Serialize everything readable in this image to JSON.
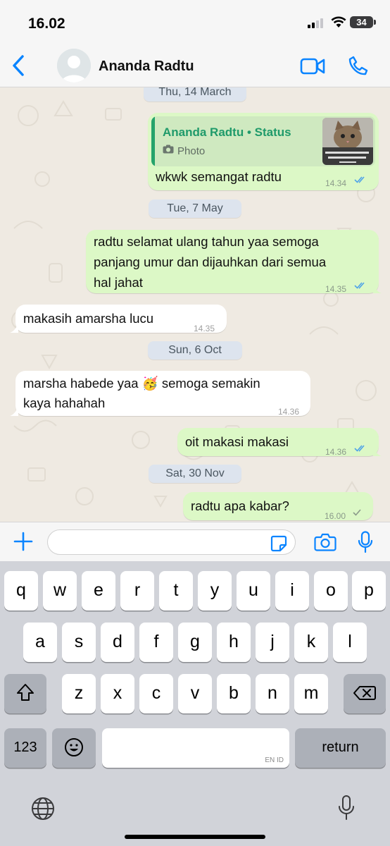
{
  "status_bar": {
    "time": "16.02",
    "battery": "34"
  },
  "header": {
    "contact_name": "Ananda Radtu"
  },
  "messages": [
    {
      "type": "date",
      "label": "Thu, 14 March"
    },
    {
      "type": "outgoing_reply",
      "quote_author": "Ananda Radtu • Status",
      "quote_type": "Photo",
      "text": "wkwk semangat radtu",
      "time": "14.34",
      "status": "read"
    },
    {
      "type": "date",
      "label": "Tue, 7 May"
    },
    {
      "type": "outgoing",
      "lines": [
        "radtu selamat ulang tahun yaa semoga",
        "panjang umur dan dijauhkan dari semua",
        "hal jahat"
      ],
      "time": "14.35",
      "status": "read"
    },
    {
      "type": "incoming",
      "lines": [
        "makasih amarsha lucu"
      ],
      "time": "14.35"
    },
    {
      "type": "date",
      "label": "Sun, 6 Oct"
    },
    {
      "type": "incoming",
      "lines": [
        "marsha habede yaa 🥳 semoga semakin",
        "kaya hahahah"
      ],
      "time": "14.36"
    },
    {
      "type": "outgoing",
      "lines": [
        "oit makasi makasi"
      ],
      "time": "14.36",
      "status": "read"
    },
    {
      "type": "date",
      "label": "Sat, 30 Nov"
    },
    {
      "type": "outgoing",
      "lines": [
        "radtu apa kabar?"
      ],
      "time": "16.00",
      "status": "sent"
    }
  ],
  "composer": {
    "input_value": "",
    "input_placeholder": ""
  },
  "keyboard": {
    "row1": [
      "q",
      "w",
      "e",
      "r",
      "t",
      "y",
      "u",
      "i",
      "o",
      "p"
    ],
    "row2": [
      "a",
      "s",
      "d",
      "f",
      "g",
      "h",
      "j",
      "k",
      "l"
    ],
    "row3": [
      "z",
      "x",
      "c",
      "v",
      "b",
      "n",
      "m"
    ],
    "numbers_key": "123",
    "space_language": "EN ID",
    "return_key": "return"
  },
  "colors": {
    "accent_blue": "#0a84ff",
    "outgoing_bubble": "#dcf8c6",
    "incoming_bubble": "#ffffff",
    "read_ticks": "#4fa3e8",
    "status_author": "#1f9a6a",
    "chat_background": "#efeae2"
  },
  "icons": [
    "back-chevron-icon",
    "video-call-icon",
    "phone-call-icon",
    "plus-icon",
    "sticker-icon",
    "camera-icon",
    "microphone-icon",
    "shift-icon",
    "backspace-icon",
    "emoji-icon",
    "globe-icon",
    "dictation-icon"
  ]
}
